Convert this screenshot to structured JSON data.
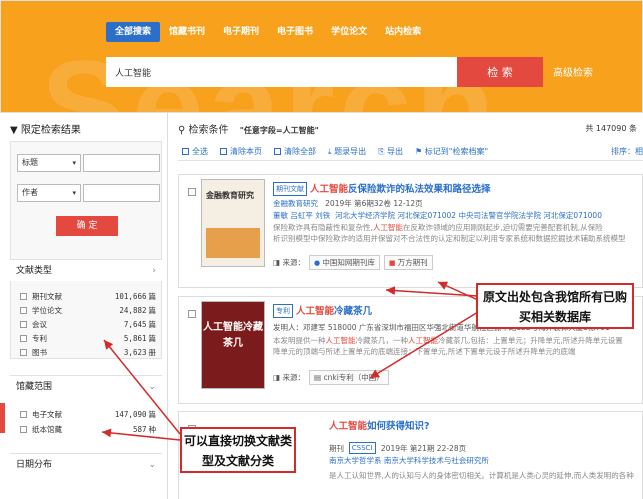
{
  "header": {
    "tabs": [
      "全部搜索",
      "馆藏书刊",
      "电子期刊",
      "电子图书",
      "学位论文",
      "站内检索"
    ],
    "search_value": "人工智能",
    "search_button": "检 索",
    "advanced": "高级检索",
    "deco": "Search"
  },
  "sidebar": {
    "title": "限定检索结果",
    "field1": "标题",
    "field2": "作者",
    "confirm": "确 定",
    "doc_type_title": "文献类型",
    "doc_types": [
      {
        "label": "期刊文献",
        "count": "101,666",
        "unit": "篇"
      },
      {
        "label": "学位论文",
        "count": "24,882",
        "unit": "篇"
      },
      {
        "label": "会议",
        "count": "7,645",
        "unit": "篇"
      },
      {
        "label": "专利",
        "count": "5,861",
        "unit": "篇"
      },
      {
        "label": "图书",
        "count": "3,623",
        "unit": "册"
      }
    ],
    "holding_title": "馆藏范围",
    "holdings": [
      {
        "label": "电子文献",
        "count": "147,090",
        "unit": "篇"
      },
      {
        "label": "纸本馆藏",
        "count": "587",
        "unit": "种"
      }
    ],
    "date_title": "日期分布"
  },
  "main": {
    "cond_label": "检索条件",
    "cond_value": "\"任意字段=人工智能\"",
    "total": "共 147090 条",
    "toolbar": [
      "全选",
      "清除本页",
      "清除全部",
      "题录导出",
      "导出",
      "标记到\"检索档案\"",
      "检索"
    ],
    "sort": "排序：相",
    "results": [
      {
        "type_badge": "期刊文献",
        "title_hl": "人工智能",
        "title_rest": "反保险欺诈的私法效果和路径选择",
        "journal": "金融教育研究",
        "date": "2019年 第6期32卷 12-12页",
        "authors": "董敏 吕虹平 刘铁",
        "org": "河北大学经济学院 河北保定071002 中央司法警官学院法学院 河北保定071000",
        "abs1": "保险欺诈具有隐蔽性和复杂性,",
        "abs_hl": "人工智能",
        "abs2": "在反欺诈领域的应用刚刚起步,迫切需要完善配套机制,从保险",
        "abs3": "析识别模型中保险欺诈的适用并保留对不合法性的认定和制定以利用专家系统和数据挖掘技术辅助系统模型",
        "src_label": "来源：",
        "src1": "中国知网期刊库",
        "src2": "万方期刊",
        "thumb_text": "金融教育研究"
      },
      {
        "type_badge": "专利",
        "title_hl": "人工智能",
        "title_rest": "冷藏茶几",
        "meta": "发明人：邓建军  518000 广东省深圳市福田区华强北街道华航社区振华路122号海外装饰大厦3栋701",
        "abs1": "本发明提供一种",
        "abs_hl": "人工智能",
        "abs2": "冷藏茶几，一种",
        "abs_hl2": "人工智能",
        "abs3": "冷藏茶几,包括：上置单元；升降单元,所述升降单元设置",
        "abs4": "降单元的顶端与所述上置单元的底端连接；下置单元,所述下置单元设于所述升降单元的底端",
        "src_label": "来源：",
        "src1": "cnki专利（中国）",
        "thumb_text": "人工智能冷藏茶几"
      },
      {
        "type_badge": "",
        "title_hl": "人工智能",
        "title_rest": "如何获得知识?",
        "meta1": "期刊",
        "cssci": "CSSCI",
        "date": "2019年 第21期 22-28页",
        "org": "南京大学哲学系 南京大学科学技术与社会研究所",
        "abs": "是人工认知世界,人的认知与人的身体密切相关。计算机是人类心灵的延伸,而人类发明的各种"
      }
    ]
  },
  "callouts": {
    "right": "原文出处包含我馆所有已购买相关数据库",
    "left": "可以直接切换文献类型及文献分类"
  }
}
